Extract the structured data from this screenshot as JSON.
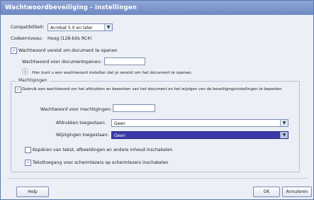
{
  "window": {
    "title": "Wachtwoordbeveiliging - instellingen"
  },
  "compat": {
    "label": "Compatibiliteit:",
    "value": "Acrobat 5.0 en later"
  },
  "encryption": {
    "label": "Codeerniveau:",
    "value": "Hoog (128-bits RC4)"
  },
  "open_password": {
    "checkbox_label": "Wachtwoord vereist om document te openen",
    "field_label": "Wachtwoord voor documentopenen:",
    "field_value": "",
    "info_text": "Hier kunt u een wachtwoord instellen dat je vereist om het document te openen."
  },
  "permissions": {
    "group_label": "Machtigingen",
    "restrict_label": "Gebruik een wachtwoord om het afdrukken en bewerken van het document en het wijzigen van de beveiligingsinstellingen te beperken",
    "perm_password_label": "Wachtwoord voor machtigingen:",
    "perm_password_value": "",
    "printing_label": "Afdrukken toegestaan:",
    "printing_value": "Geen",
    "changes_label": "Wijzigingen toegestaan:",
    "changes_value": "Geen",
    "copy_label": "Kopiëren van tekst, afbeeldingen en andere inhoud inschakelen",
    "screenreader_label": "Teksttoegang voor schermlezers op schermlezers inschakelen"
  },
  "buttons": {
    "help": "Help",
    "ok": "OK",
    "cancel": "Annuleren"
  },
  "icons": {
    "info": "info-icon",
    "dropdown": "chevron-down-icon",
    "check": "checkmark-icon"
  }
}
